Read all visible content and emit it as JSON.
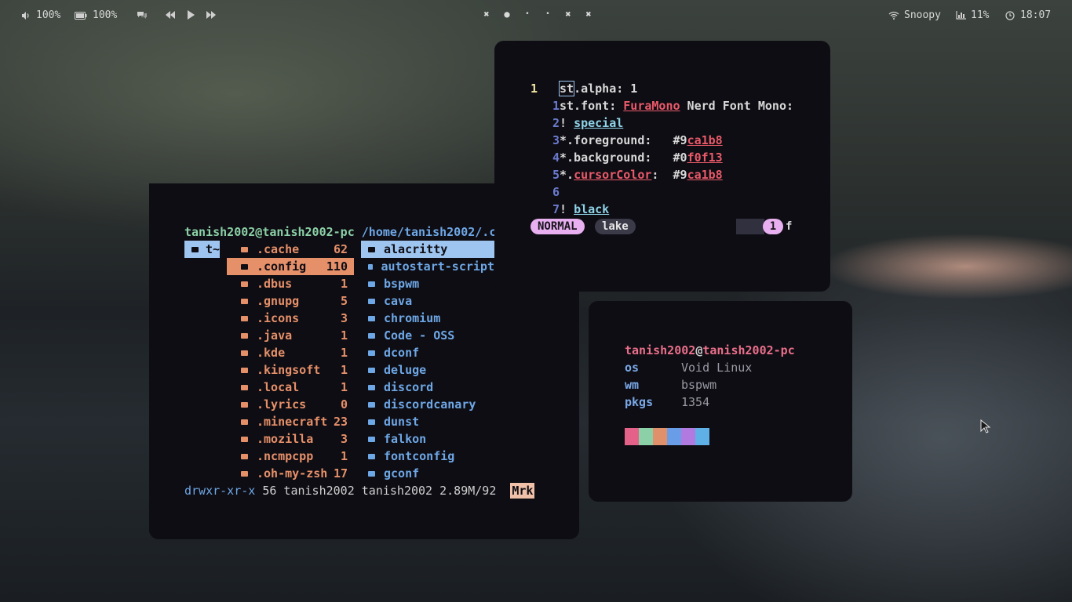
{
  "topbar": {
    "volume": "100%",
    "battery": "100%",
    "wifi_name": "Snoopy",
    "cpu": "11%",
    "clock": "18:07",
    "icons": [
      "volume-icon",
      "battery-icon",
      "chat-icon",
      "prev-icon",
      "play-icon",
      "next-icon",
      "wifi-icon",
      "chart-icon",
      "clock-icon"
    ],
    "workspaces": [
      "✖",
      "●",
      "•",
      "•",
      "✖",
      "✖"
    ]
  },
  "file_manager": {
    "title_user": "tanish2002@tanish2002-pc",
    "title_path": "/home/tanish2002/.c",
    "left_col": [
      {
        "name": "t~",
        "selected": true
      }
    ],
    "mid_col": [
      {
        "name": ".cache",
        "count": "62"
      },
      {
        "name": ".config",
        "count": "110",
        "selected": true
      },
      {
        "name": ".dbus",
        "count": "1"
      },
      {
        "name": ".gnupg",
        "count": "5"
      },
      {
        "name": ".icons",
        "count": "3"
      },
      {
        "name": ".java",
        "count": "1"
      },
      {
        "name": ".kde",
        "count": "1"
      },
      {
        "name": ".kingsoft",
        "count": "1"
      },
      {
        "name": ".local",
        "count": "1"
      },
      {
        "name": ".lyrics",
        "count": "0"
      },
      {
        "name": ".minecraft",
        "count": "23"
      },
      {
        "name": ".mozilla",
        "count": "3"
      },
      {
        "name": ".ncmpcpp",
        "count": "1"
      },
      {
        "name": ".oh-my-zsh",
        "count": "17"
      }
    ],
    "right_col": [
      {
        "name": "alacritty",
        "selected": true
      },
      {
        "name": "autostart-script"
      },
      {
        "name": "bspwm"
      },
      {
        "name": "cava"
      },
      {
        "name": "chromium"
      },
      {
        "name": "Code - OSS"
      },
      {
        "name": "dconf"
      },
      {
        "name": "deluge"
      },
      {
        "name": "discord"
      },
      {
        "name": "discordcanary"
      },
      {
        "name": "dunst"
      },
      {
        "name": "falkon"
      },
      {
        "name": "fontconfig"
      },
      {
        "name": "gconf"
      }
    ],
    "status": {
      "perm": "drwxr-xr-x",
      "rest": " 56 tanish2002 tanish2002   2.89M/92",
      "mark": "Mrk"
    }
  },
  "editor": {
    "lines": [
      {
        "num": "1",
        "current": true,
        "parts": [
          {
            "t": "st",
            "cls": "cursor"
          },
          {
            "t": ".alpha: 1"
          }
        ]
      },
      {
        "num": "1",
        "parts": [
          {
            "t": "st.font: "
          },
          {
            "t": "FuraMono",
            "cls": "red"
          },
          {
            "t": " Nerd Font Mono:"
          }
        ]
      },
      {
        "num": "2",
        "parts": [
          {
            "t": "! "
          },
          {
            "t": "special",
            "cls": "cyan"
          }
        ]
      },
      {
        "num": "3",
        "parts": [
          {
            "t": "*.foreground:   #9"
          },
          {
            "t": "ca1b8",
            "cls": "red"
          }
        ]
      },
      {
        "num": "4",
        "parts": [
          {
            "t": "*.background:   #0"
          },
          {
            "t": "f0f13",
            "cls": "red"
          }
        ]
      },
      {
        "num": "5",
        "parts": [
          {
            "t": "*."
          },
          {
            "t": "cursorColor",
            "cls": "red"
          },
          {
            "t": ":  #9"
          },
          {
            "t": "ca1b8",
            "cls": "red"
          }
        ]
      },
      {
        "num": "6",
        "parts": [
          {
            "t": ""
          }
        ]
      },
      {
        "num": "7",
        "parts": [
          {
            "t": "! "
          },
          {
            "t": "black",
            "cls": "cyan"
          }
        ]
      }
    ],
    "mode": "NORMAL",
    "file": "lake",
    "pos": "1",
    "tail": "f"
  },
  "fetch": {
    "user": "tanish2002",
    "at": "@",
    "host": "tanish2002-pc",
    "rows": [
      {
        "key": "os",
        "value": "Void Linux"
      },
      {
        "key": "wm",
        "value": "bspwm"
      },
      {
        "key": "pkgs",
        "value": "1354"
      }
    ],
    "colors": [
      "#e4628a",
      "#8bd0a6",
      "#e0906a",
      "#6a9de8",
      "#b07ae0",
      "#5fb0e6"
    ]
  }
}
